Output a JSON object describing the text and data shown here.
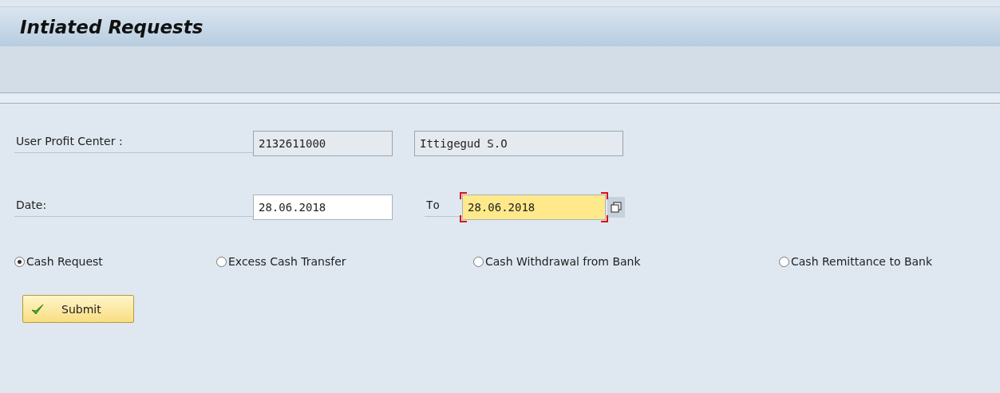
{
  "window": {
    "title": "Intiated Requests"
  },
  "form": {
    "rows": [
      {
        "label": "User Profit Center :",
        "fields": [
          {
            "value": "2132611000",
            "editable": false,
            "focused": false
          },
          {
            "value": "Ittigegud S.O",
            "editable": false,
            "focused": false
          }
        ]
      },
      {
        "label": "Date:",
        "fields": [
          {
            "value": "28.06.2018",
            "editable": true,
            "focused": false
          },
          {
            "prefix": "To",
            "value": "28.06.2018",
            "editable": true,
            "focused": true,
            "multiple_selection": true
          }
        ]
      }
    ]
  },
  "options": [
    {
      "label": "Cash Request",
      "selected": true
    },
    {
      "label": "Excess Cash Transfer",
      "selected": false
    },
    {
      "label": "Cash Withdrawal from Bank",
      "selected": false
    },
    {
      "label": "Cash Remittance to Bank",
      "selected": false
    }
  ],
  "buttons": [
    {
      "label": "Submit"
    }
  ]
}
